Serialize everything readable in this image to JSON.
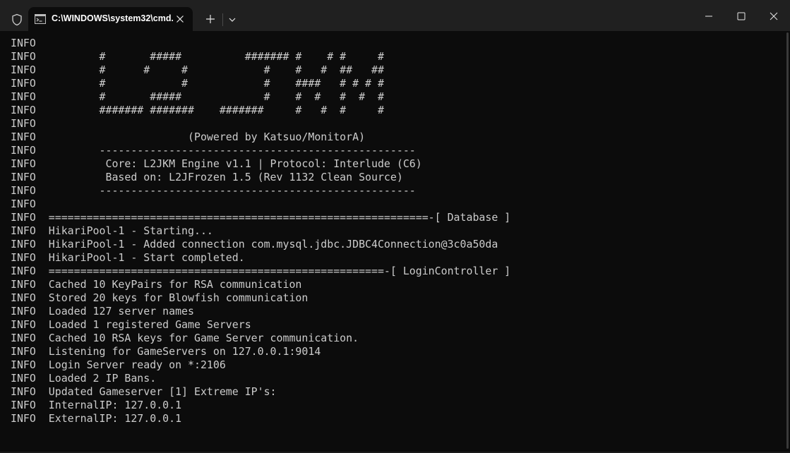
{
  "window": {
    "tab_title": "C:\\WINDOWS\\system32\\cmd.",
    "icons": {
      "shield": "shield-icon",
      "tab": "cmd-icon",
      "tab_close": "close-icon",
      "new_tab": "plus-icon",
      "dropdown": "chevron-down-icon",
      "minimize": "minimize-icon",
      "maximize": "maximize-icon",
      "close": "close-icon"
    }
  },
  "colors": {
    "background": "#0c0c0c",
    "titlebar": "#202020",
    "text": "#cccccc"
  },
  "console": {
    "lines": [
      "INFO",
      "INFO          #       #####          ####### #    # #     #",
      "INFO          #      #     #            #    #   #  ##   ##",
      "INFO          #            #            #    ####   # # # #",
      "INFO          #       #####             #    #  #   #  #  #",
      "INFO          ####### #######    #######     #   #  #     #",
      "INFO",
      "INFO                        (Powered by Katsuo/MonitorA)",
      "INFO          --------------------------------------------------",
      "INFO           Core: L2JKM Engine v1.1 | Protocol: Interlude (C6)",
      "INFO           Based on: L2JFrozen 1.5 (Rev 1132 Clean Source)",
      "INFO          --------------------------------------------------",
      "INFO",
      "INFO  ============================================================-[ Database ]",
      "INFO  HikariPool-1 - Starting...",
      "INFO  HikariPool-1 - Added connection com.mysql.jdbc.JDBC4Connection@3c0a50da",
      "INFO  HikariPool-1 - Start completed.",
      "INFO  =====================================================-[ LoginController ]",
      "INFO  Cached 10 KeyPairs for RSA communication",
      "INFO  Stored 20 keys for Blowfish communication",
      "INFO  Loaded 127 server names",
      "INFO  Loaded 1 registered Game Servers",
      "INFO  Cached 10 RSA keys for Game Server communication.",
      "INFO  Listening for GameServers on 127.0.0.1:9014",
      "INFO  Login Server ready on *:2106",
      "INFO  Loaded 2 IP Bans.",
      "INFO  Updated Gameserver [1] Extreme IP's:",
      "INFO  InternalIP: 127.0.0.1",
      "INFO  ExternalIP: 127.0.0.1"
    ]
  }
}
